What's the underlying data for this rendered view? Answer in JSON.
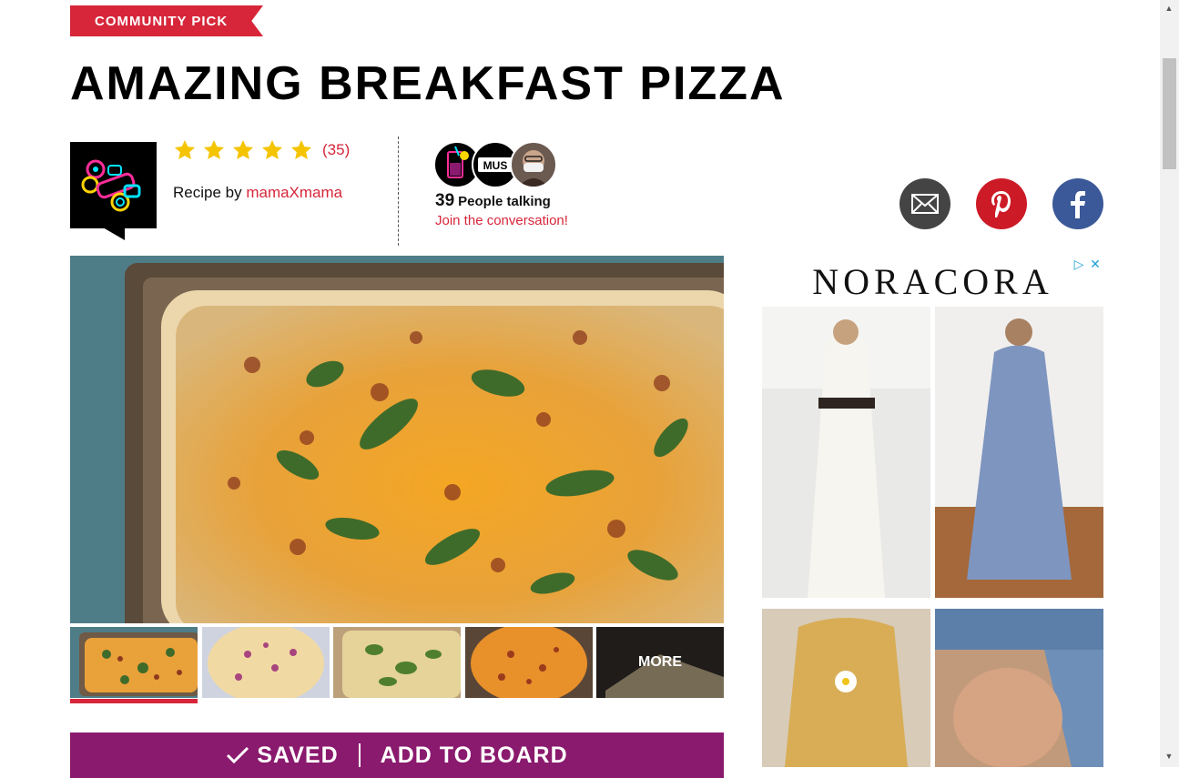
{
  "badge": {
    "label": "COMMUNITY PICK"
  },
  "recipe": {
    "title": "AMAZING BREAKFAST PIZZA",
    "rating": 5,
    "rating_count": "(35)",
    "recipe_by_prefix": "Recipe by ",
    "author": "mamaXmama"
  },
  "conversation": {
    "avatars": [
      "drink-avatar",
      "mus-avatar",
      "masked-person-avatar"
    ],
    "count": "39",
    "label": "People talking",
    "join": "Join the conversation!"
  },
  "share": {
    "icons": [
      "email-icon",
      "pinterest-icon",
      "facebook-icon"
    ]
  },
  "gallery": {
    "thumb_count": 5,
    "more_label": "MORE"
  },
  "actions": {
    "saved_label": "SAVED",
    "add_to_board_label": "ADD TO BOARD"
  },
  "ad": {
    "brand": "NORACORA"
  },
  "colors": {
    "accent_red": "#d7263a",
    "save_bar": "#8a1a6e",
    "facebook": "#3b5998",
    "pinterest": "#cc1b27",
    "email": "#444444",
    "star": "#f5c400"
  }
}
